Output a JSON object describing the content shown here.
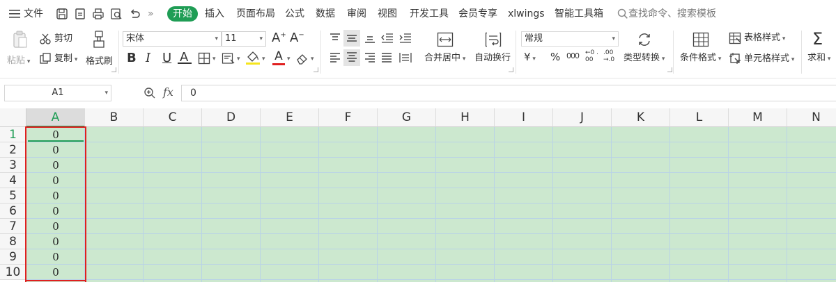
{
  "menubar": {
    "menu_label": "文件",
    "more_label": "»",
    "tabs": [
      "开始",
      "插入",
      "页面布局",
      "公式",
      "数据",
      "审阅",
      "视图",
      "开发工具",
      "会员专享",
      "xlwings",
      "智能工具箱"
    ],
    "active_tab": "开始",
    "search_placeholder": "查找命令、搜索模板"
  },
  "ribbon": {
    "paste": "粘贴",
    "cut": "剪切",
    "copy": "复制",
    "format_painter": "格式刷",
    "font_name": "宋体",
    "font_size": "11",
    "bold": "B",
    "italic": "I",
    "underline": "U",
    "strike": "A",
    "merge_center": "合并居中",
    "wrap_text": "自动换行",
    "number_format": "常规",
    "currency": "¥",
    "percent": "%",
    "thousands": "000",
    "inc_decimal": "←0 .00",
    "dec_decimal": ".00 →.0",
    "type_convert": "类型转换",
    "conditional_format": "条件格式",
    "table_style": "表格样式",
    "cell_style": "单元格样式",
    "sum": "求和",
    "sum_symbol": "Σ"
  },
  "formula_bar": {
    "name_box": "A1",
    "fx": "fx",
    "content": "0"
  },
  "grid": {
    "columns": [
      "A",
      "B",
      "C",
      "D",
      "E",
      "F",
      "G",
      "H",
      "I",
      "J",
      "K",
      "L",
      "M",
      "N"
    ],
    "rows": [
      "1",
      "2",
      "3",
      "4",
      "5",
      "6",
      "7",
      "8",
      "9",
      "10"
    ],
    "column_a_values": [
      "0",
      "0",
      "0",
      "0",
      "0",
      "0",
      "0",
      "0",
      "0",
      "0"
    ],
    "selected_column": "A",
    "active_cell": "A1"
  },
  "colors": {
    "accent": "#1f9d55",
    "cell_fill": "#cce8cf",
    "selection_border": "#e02020",
    "font_color_bar": "#e02020",
    "highlight_bar": "#f5e51c"
  }
}
